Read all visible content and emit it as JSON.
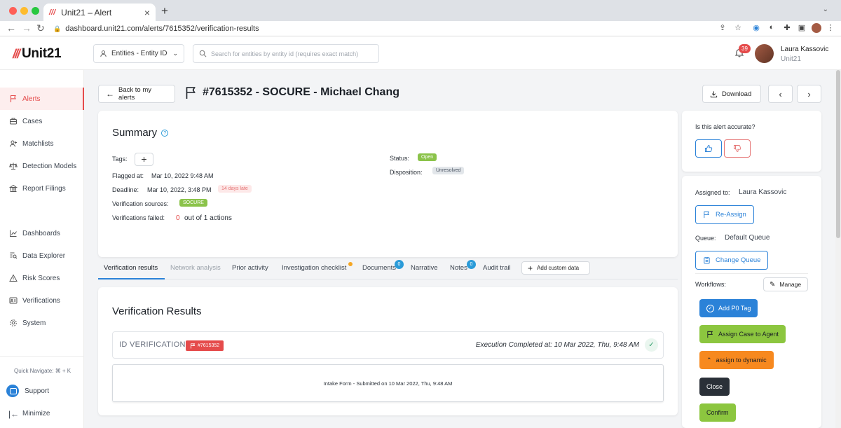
{
  "browser": {
    "tab_title": "Unit21 – Alert",
    "tab_favicon": "///",
    "new_tab_symbol": "+",
    "url": "dashboard.unit21.com/alerts/7615352/verification-results"
  },
  "header": {
    "logo_text": "Unit21",
    "logo_mark": "///",
    "entity_selector": "Entities - Entity ID",
    "search_placeholder": "Search for entities by entity id (requires exact match)",
    "notification_count": "39",
    "user_name": "Laura Kassovic",
    "user_org": "Unit21"
  },
  "sidebar": {
    "items": [
      {
        "label": "Alerts",
        "icon": "flag-icon",
        "active": true
      },
      {
        "label": "Cases",
        "icon": "briefcase-icon"
      },
      {
        "label": "Matchlists",
        "icon": "user-plus-icon"
      },
      {
        "label": "Detection Models",
        "icon": "scale-icon"
      },
      {
        "label": "Report Filings",
        "icon": "bank-icon"
      },
      {
        "label": "Dashboards",
        "icon": "chart-icon"
      },
      {
        "label": "Data Explorer",
        "icon": "data-search-icon"
      },
      {
        "label": "Risk Scores",
        "icon": "warning-icon"
      },
      {
        "label": "Verifications",
        "icon": "id-card-icon"
      },
      {
        "label": "System",
        "icon": "gear-icon"
      }
    ],
    "quick_navigate": "Quick Navigate: ⌘ + K",
    "support": "Support",
    "minimize": "Minimize"
  },
  "page": {
    "back_label": "Back to my alerts",
    "title": "#7615352 - SOCURE - Michael Chang",
    "download_label": "Download"
  },
  "summary": {
    "title": "Summary",
    "tags_label": "Tags:",
    "flagged_label": "Flagged at:",
    "flagged_value": "Mar 10, 2022 9:48 AM",
    "deadline_label": "Deadline:",
    "deadline_value": "Mar 10, 2022, 3:48 PM",
    "deadline_badge": "14 days late",
    "sources_label": "Verification sources:",
    "sources_value": "SOCURE",
    "failed_label": "Verifications failed:",
    "failed_count": "0",
    "failed_suffix": "out of 1 actions",
    "status_label": "Status:",
    "status_value": "Open",
    "disposition_label": "Disposition:",
    "disposition_value": "Unresolved"
  },
  "tabs": [
    {
      "label": "Verification results",
      "state": "active"
    },
    {
      "label": "Network analysis",
      "state": "disabled"
    },
    {
      "label": "Prior activity"
    },
    {
      "label": "Investigation checklist",
      "dot": true
    },
    {
      "label": "Documents",
      "count": "0"
    },
    {
      "label": "Narrative"
    },
    {
      "label": "Notes",
      "count": "0"
    },
    {
      "label": "Audit trail"
    }
  ],
  "add_custom_label": "Add custom data",
  "verification": {
    "title": "Verification Results",
    "id_label": "ID VERIFICATION",
    "id_tag": "#7615352",
    "execution": "Execution Completed at: 10 Mar 2022, Thu, 9:48 AM",
    "intake": "Intake Form - Submitted on 10 Mar 2022, Thu, 9:48 AM"
  },
  "right_panel": {
    "accuracy_question": "Is this alert accurate?",
    "assigned_label": "Assigned to:",
    "assigned_value": "Laura Kassovic",
    "reassign_label": "Re-Assign",
    "queue_label": "Queue:",
    "queue_value": "Default Queue",
    "change_queue_label": "Change Queue",
    "workflows_label": "Workflows:",
    "manage_label": "Manage",
    "workflows": [
      {
        "label": "Add P0 Tag",
        "color": "#2b82d8"
      },
      {
        "label": "Assign Case to Agent",
        "color": "#8cc63f"
      },
      {
        "label": "assign to dynamic",
        "color": "#f7891f"
      },
      {
        "label": "Close",
        "color": "#2a3038"
      },
      {
        "label": "Confirm",
        "color": "#8cc63f"
      }
    ]
  },
  "colors": {
    "brand_red": "#e54b4b",
    "accent_blue": "#2b82d8",
    "green": "#8cc63f",
    "orange": "#f7891f"
  }
}
